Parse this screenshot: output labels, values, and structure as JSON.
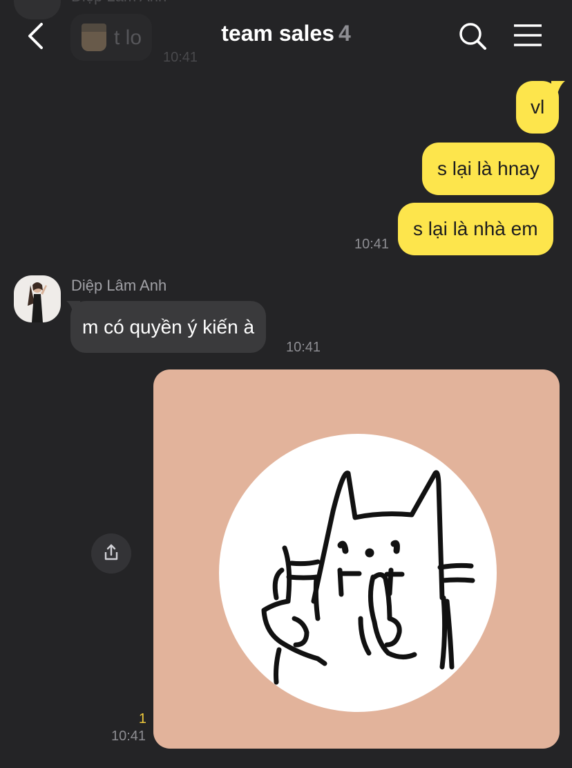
{
  "previous_message": {
    "sender": "Diệp Lâm Anh",
    "text": "t lo",
    "time": "10:41"
  },
  "header": {
    "title": "team sales",
    "member_count": "4",
    "icons": [
      "back-chevron-icon",
      "search-icon",
      "menu-icon"
    ]
  },
  "messages_out": [
    {
      "text": "vl"
    },
    {
      "text": "s lại là hnay"
    },
    {
      "text": "s lại là nhà em",
      "time": "10:41"
    }
  ],
  "message_in": {
    "sender": "Diệp Lâm Anh",
    "text": "m có quyền ý kiến à",
    "time": "10:41"
  },
  "image_message": {
    "read_count": "1",
    "time": "10:41",
    "share_icon": "share-icon"
  },
  "colors": {
    "background": "#242426",
    "outgoing_bubble": "#fde54c",
    "incoming_bubble": "#3a3a3c",
    "sticker_bg": "#e2b39b",
    "unread_count": "#f2cc3c"
  }
}
